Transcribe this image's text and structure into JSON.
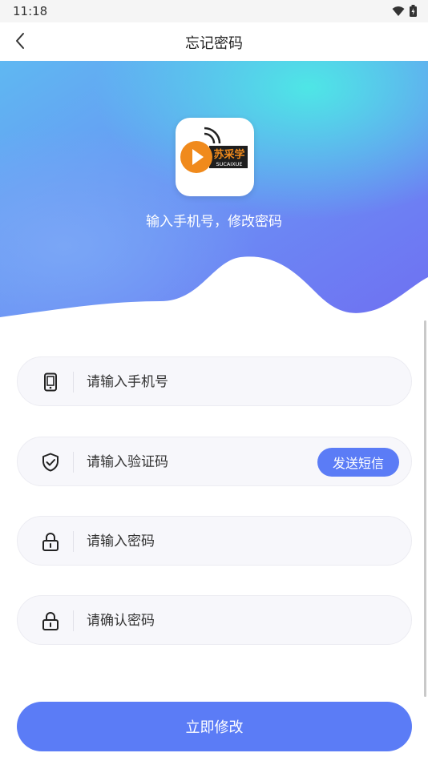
{
  "status_bar": {
    "time": "11:18"
  },
  "header": {
    "title": "忘记密码"
  },
  "hero": {
    "logo_text": "苏采学",
    "logo_subtext": "SUCAIXUE",
    "subtitle": "输入手机号，修改密码"
  },
  "form": {
    "phone_placeholder": "请输入手机号",
    "code_placeholder": "请输入验证码",
    "send_sms_label": "发送短信",
    "password_placeholder": "请输入密码",
    "confirm_placeholder": "请确认密码"
  },
  "submit_label": "立即修改",
  "colors": {
    "accent": "#5b7cf6",
    "logo_orange": "#f08a1c"
  },
  "icons": [
    "back-arrow-icon",
    "wifi-icon",
    "battery-icon",
    "phone-icon",
    "shield-check-icon",
    "lock-icon"
  ]
}
